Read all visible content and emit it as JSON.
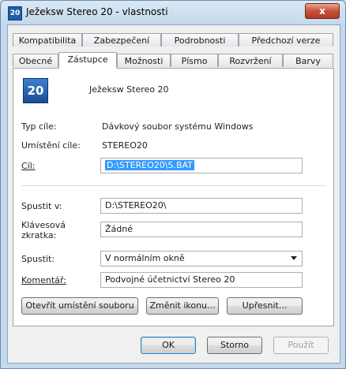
{
  "window": {
    "title": "Ježeksw Stereo 20 - vlastnosti",
    "icon_text": "20",
    "close_label": "x"
  },
  "tabs_row1": [
    "Kompatibilita",
    "Zabezpečení",
    "Podrobnosti",
    "Předchozí verze"
  ],
  "tabs_row2": [
    "Obecné",
    "Zástupce",
    "Možnosti",
    "Písmo",
    "Rozvržení",
    "Barvy"
  ],
  "active_tab": "Zástupce",
  "shortcut": {
    "icon_text": "20",
    "name": "Ježeksw Stereo 20",
    "target_type_label": "Typ cíle:",
    "target_type_value": "Dávkový soubor systému Windows",
    "target_location_label": "Umístění cíle:",
    "target_location_value": "STEREO20",
    "target_label": "Cíl:",
    "target_value": "D:\\STEREO20\\S.BAT",
    "start_in_label": "Spustit v:",
    "start_in_value": "D:\\STEREO20\\",
    "hotkey_label_line1": "Klávesová",
    "hotkey_label_line2": "zkratka:",
    "hotkey_value": "Žádné",
    "run_label": "Spustit:",
    "run_value": "V normálním okně",
    "comment_label": "Komentář:",
    "comment_value": "Podvojné účetnictví Stereo 20",
    "open_location_button": "Otevřít umístění souboru",
    "change_icon_button": "Změnit ikonu...",
    "advanced_button": "Upřesnit..."
  },
  "footer": {
    "ok": "OK",
    "cancel": "Storno",
    "apply": "Použít"
  }
}
